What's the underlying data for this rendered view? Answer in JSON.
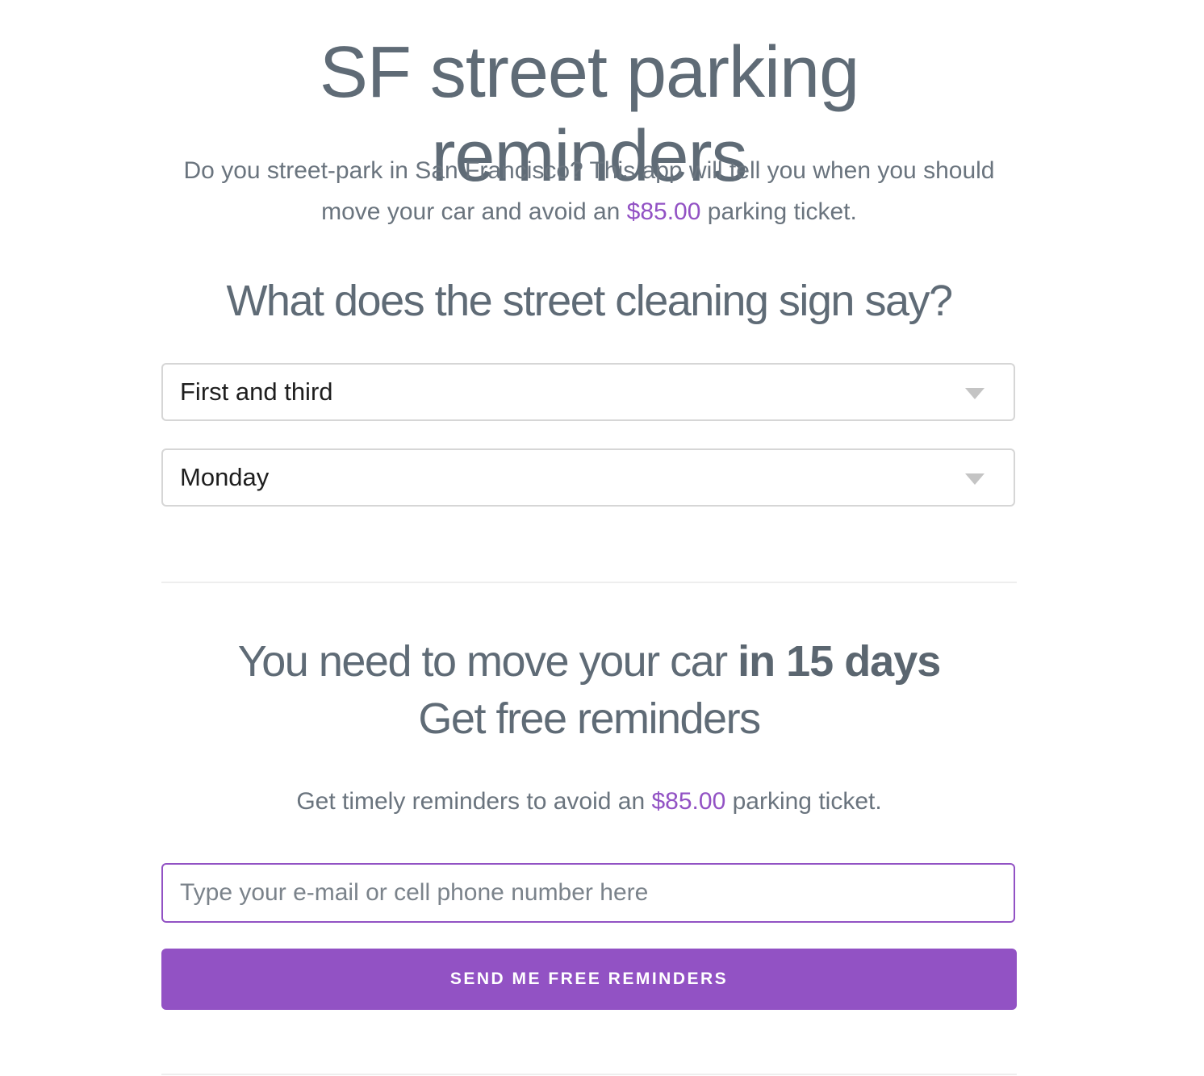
{
  "header": {
    "title": "SF street parking reminders"
  },
  "intro": {
    "text_before": "Do you street-park in San Francisco? This app will tell you when you should move your car and avoid an ",
    "price": "$85.00",
    "text_after": " parking ticket."
  },
  "sign_section": {
    "heading": "What does the street cleaning sign say?",
    "week_select": {
      "selected": "First and third",
      "icon": "chevron-down-icon"
    },
    "day_select": {
      "selected": "Monday",
      "icon": "chevron-down-icon"
    }
  },
  "result": {
    "line1_prefix": "You need to move your car ",
    "line1_emphasis": "in 15 days",
    "line2": "Get free reminders"
  },
  "reminders": {
    "text_before": "Get timely reminders to avoid an ",
    "price": "$85.00",
    "text_after": " parking ticket.",
    "input_placeholder": "Type your e-mail or cell phone number here",
    "input_value": "",
    "button_label": "SEND ME FREE REMINDERS"
  },
  "colors": {
    "accent": "#9252c4",
    "text": "#5f6b76",
    "border": "#d6d6d6"
  }
}
